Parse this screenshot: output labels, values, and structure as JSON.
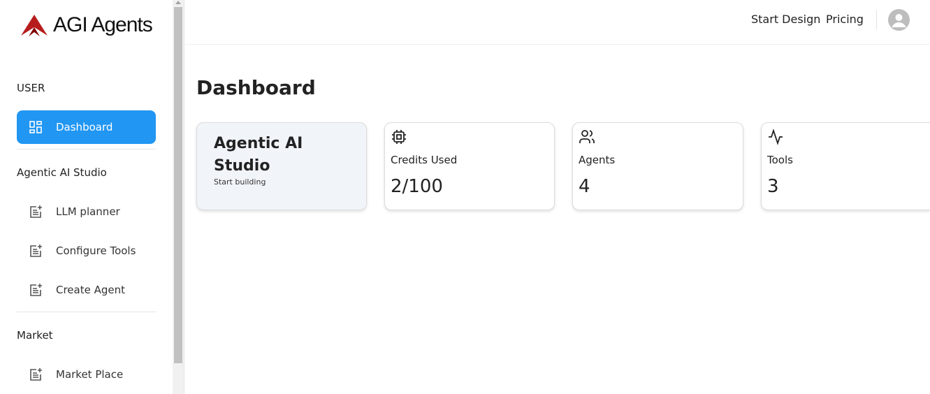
{
  "brand": {
    "name": "AGI Agents",
    "logo_color": "#b71c1c"
  },
  "sidebar": {
    "sections": [
      {
        "label": "USER"
      },
      {
        "label": "Agentic AI Studio"
      },
      {
        "label": "Market"
      }
    ],
    "items": [
      {
        "label": "Dashboard",
        "icon": "dashboard-icon",
        "active": true
      },
      {
        "label": "LLM planner",
        "icon": "post-add-icon"
      },
      {
        "label": "Configure Tools",
        "icon": "post-add-icon"
      },
      {
        "label": "Create Agent",
        "icon": "post-add-icon"
      },
      {
        "label": "Market Place",
        "icon": "post-add-icon"
      }
    ]
  },
  "header": {
    "links": [
      {
        "label": "Start Design"
      },
      {
        "label": "Pricing"
      }
    ],
    "avatar_icon": "account-circle-icon"
  },
  "main": {
    "title": "Dashboard",
    "studio_card": {
      "title": "Agentic AI Studio",
      "subtitle": "Start building"
    },
    "stats": [
      {
        "label": "Credits Used",
        "value": "2/100",
        "icon": "cpu-chip-icon"
      },
      {
        "label": "Agents",
        "value": "4",
        "icon": "users-icon"
      },
      {
        "label": "Tools",
        "value": "3",
        "icon": "activity-icon"
      }
    ]
  },
  "colors": {
    "accent": "#2196f3",
    "studio_card_bg": "#f1f4f9"
  }
}
